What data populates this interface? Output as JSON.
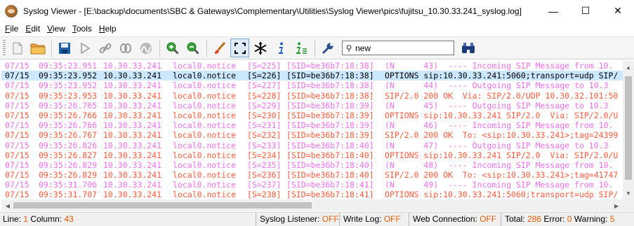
{
  "window": {
    "title": "Syslog Viewer - [E:\\backup\\documents\\SBC & Gateways\\Complementary\\Utilities\\Syslog Viewer\\pics\\fujitsu_10.30.33.241_syslog.log]",
    "minimize": "—",
    "maximize": "☐",
    "close": "✕"
  },
  "menu": [
    {
      "accel": "F",
      "rest": "ile"
    },
    {
      "accel": "E",
      "rest": "dit"
    },
    {
      "accel": "V",
      "rest": "iew"
    },
    {
      "accel": "T",
      "rest": "ools"
    },
    {
      "accel": "H",
      "rest": "elp"
    }
  ],
  "toolbar": {
    "search_value": "new",
    "icons": [
      "new-file-icon",
      "open-folder-icon",
      "save-icon",
      "play-icon",
      "link-icon",
      "rewind-icon",
      "wave-icon",
      "zoom-in-icon",
      "zoom-out-icon",
      "brush-icon",
      "fullscreen-icon",
      "freeze-icon",
      "info-icon",
      "info-settings-icon",
      "wrench-icon",
      "binoculars-icon"
    ]
  },
  "colors": {
    "outgoing": "#f070f0",
    "incoming_other": "#ff5a3c",
    "default_text": "#ff5a3c",
    "selected_text": "#000000",
    "selected_bg": "#cce8ff",
    "status_value": "#e65c00"
  },
  "log_rows": [
    {
      "date": "07/15",
      "time": "09:35:23.951",
      "ip": "10.30.33.241",
      "fac": "local0.notice",
      "seq": "[S=225]",
      "sid": "[SID=be36b7:18:38]",
      "msg": "(N      43)  ---- Incoming SIP Message from 10.",
      "color": "#f070f0",
      "selected": false
    },
    {
      "date": "07/15",
      "time": "09:35:23.952",
      "ip": "10.30.33.241",
      "fac": "local0.notice",
      "seq": "[S=226]",
      "sid": "[SID=be36b7:18:38]",
      "msg": "OPTIONS sip:10.30.33.241:5060;transport=udp SIP/",
      "color": "#000000",
      "selected": true
    },
    {
      "date": "07/15",
      "time": "09:35:23.952",
      "ip": "10.30.33.241",
      "fac": "local0.notice",
      "seq": "[S=227]",
      "sid": "[SID=be36b7:18:38]",
      "msg": "(N      44)  ---- Outgoing SIP Message to 10.3",
      "color": "#f070f0",
      "selected": false
    },
    {
      "date": "07/15",
      "time": "09:35:23.953",
      "ip": "10.30.33.241",
      "fac": "local0.notice",
      "seq": "[S=228]",
      "sid": "[SID=be36b7:18:38]",
      "msg": "SIP/2.0 200 OK  Via: SIP/2.0/UDP 10.30.32.101:50",
      "color": "#ff5a3c",
      "selected": false
    },
    {
      "date": "07/15",
      "time": "09:35:26.765",
      "ip": "10.30.33.241",
      "fac": "local0.notice",
      "seq": "[S=229]",
      "sid": "[SID=be36b7:18:39]",
      "msg": "(N      45)  ---- Outgoing SIP Message to 10.3",
      "color": "#f070f0",
      "selected": false
    },
    {
      "date": "07/15",
      "time": "09:35:26.766",
      "ip": "10.30.33.241",
      "fac": "local0.notice",
      "seq": "[S=230]",
      "sid": "[SID=be36b7:18:39]",
      "msg": "OPTIONS sip:10.30.33.241 SIP/2.0  Via: SIP/2.0/U",
      "color": "#ff5a3c",
      "selected": false
    },
    {
      "date": "07/15",
      "time": "09:35:26.766",
      "ip": "10.30.33.241",
      "fac": "local0.notice",
      "seq": "[S=231]",
      "sid": "[SID=be36b7:18:39]",
      "msg": "(N      46)  ---- Incoming SIP Message from 10.",
      "color": "#f070f0",
      "selected": false
    },
    {
      "date": "07/15",
      "time": "09:35:26.767",
      "ip": "10.30.33.241",
      "fac": "local0.notice",
      "seq": "[S=232]",
      "sid": "[SID=be36b7:18:39]",
      "msg": "SIP/2.0 200 OK  To: <sip:10.30.33.241>;tag=24399",
      "color": "#ff5a3c",
      "selected": false
    },
    {
      "date": "07/15",
      "time": "09:35:26.826",
      "ip": "10.30.33.241",
      "fac": "local0.notice",
      "seq": "[S=233]",
      "sid": "[SID=be36b7:18:40]",
      "msg": "(N      47)  ---- Outgoing SIP Message to 10.3",
      "color": "#f070f0",
      "selected": false
    },
    {
      "date": "07/15",
      "time": "09:35:26.827",
      "ip": "10.30.33.241",
      "fac": "local0.notice",
      "seq": "[S=234]",
      "sid": "[SID=be36b7:18:40]",
      "msg": "OPTIONS sip:10.30.33.241 SIP/2.0  Via: SIP/2.0/U",
      "color": "#ff5a3c",
      "selected": false
    },
    {
      "date": "07/15",
      "time": "09:35:26.829",
      "ip": "10.30.33.241",
      "fac": "local0.notice",
      "seq": "[S=235]",
      "sid": "[SID=be36b7:18:40]",
      "msg": "(N      48)  ---- Incoming SIP Message from 10.",
      "color": "#f070f0",
      "selected": false
    },
    {
      "date": "07/15",
      "time": "09:35:26.829",
      "ip": "10.30.33.241",
      "fac": "local0.notice",
      "seq": "[S=236]",
      "sid": "[SID=be36b7:18:40]",
      "msg": "SIP/2.0 200 OK  To: <sip:10.30.33.241>;tag=41747",
      "color": "#ff5a3c",
      "selected": false
    },
    {
      "date": "07/15",
      "time": "09:35:31.706",
      "ip": "10.30.33.241",
      "fac": "local0.notice",
      "seq": "[S=237]",
      "sid": "[SID=be36b7:18:41]",
      "msg": "(N      49)  ---- Incoming SIP Message from 10.",
      "color": "#f070f0",
      "selected": false
    },
    {
      "date": "07/15",
      "time": "09:35:31.707",
      "ip": "10.30.33.241",
      "fac": "local0.notice",
      "seq": "[S=238]",
      "sid": "[SID=be36b7:18:41]",
      "msg": "OPTIONS sip:10.30.33.241:5060;transport=udp SIP/",
      "color": "#ff5a3c",
      "selected": false
    }
  ],
  "status": {
    "line_label": "Line:",
    "line_value": "1",
    "column_label": "Column:",
    "column_value": "43",
    "listener_label": "Syslog Listener:",
    "listener_value": "OFF",
    "writelog_label": "Write Log:",
    "writelog_value": "OFF",
    "webconn_label": "Web Connection:",
    "webconn_value": "OFF",
    "total_label": "Total:",
    "total_value": "286",
    "error_label": "Error:",
    "error_value": "0",
    "warning_label": "Warning:",
    "warning_value": "5"
  }
}
